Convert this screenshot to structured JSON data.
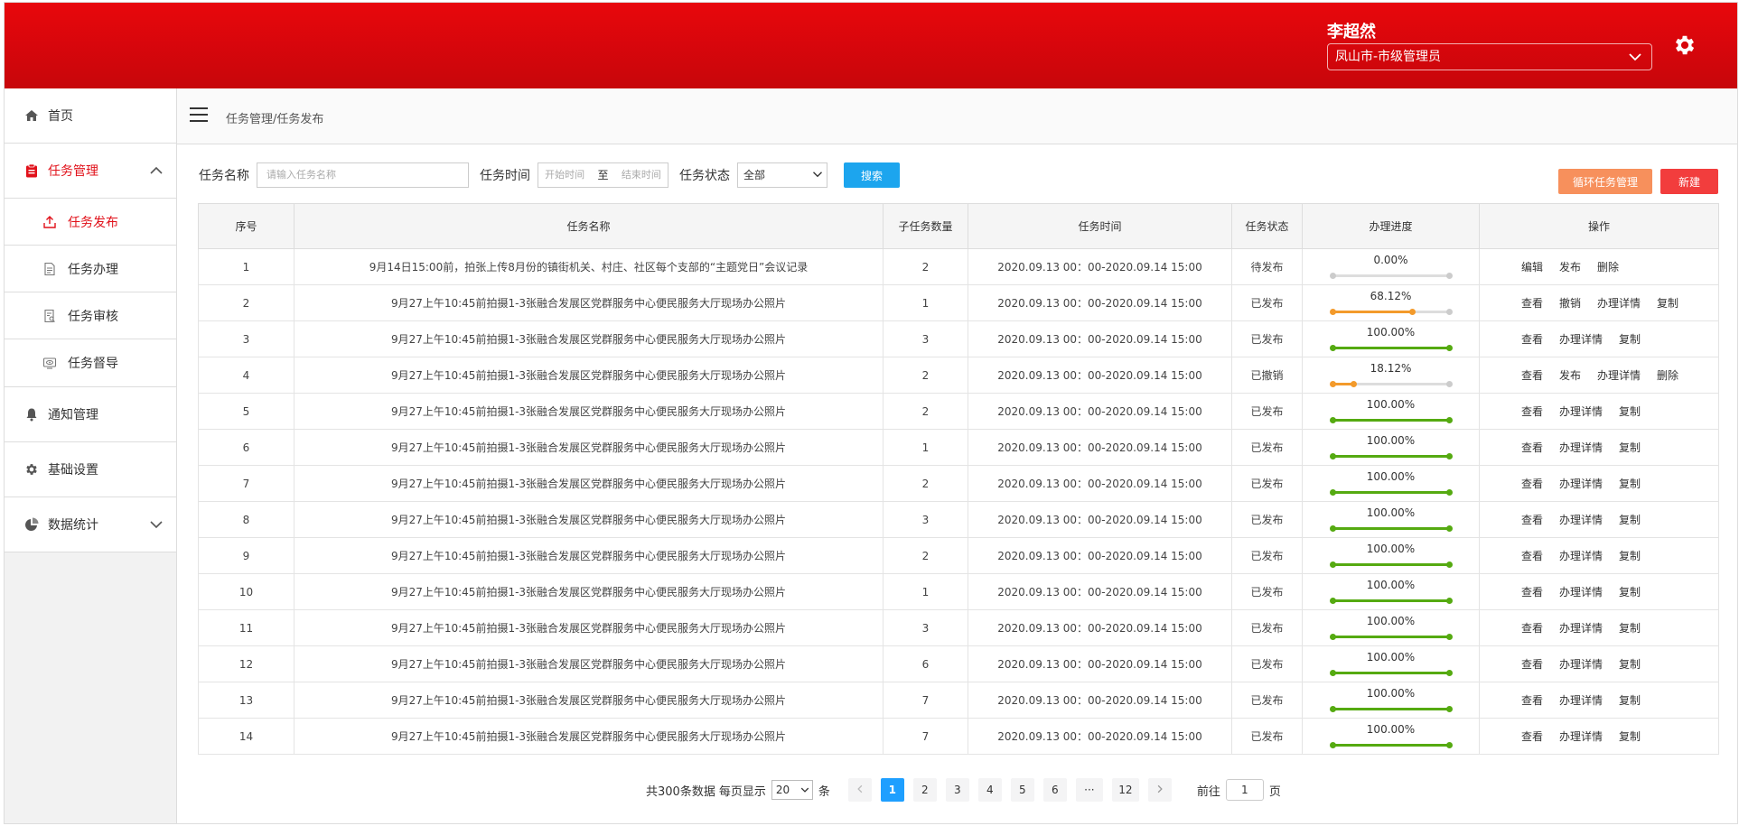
{
  "header": {
    "user_name": "李超然",
    "role": "凤山市-市级管理员"
  },
  "sidebar": {
    "home": "首页",
    "task_mgmt": "任务管理",
    "sub": [
      "任务发布",
      "任务办理",
      "任务审核",
      "任务督导"
    ],
    "notice": "通知管理",
    "settings": "基础设置",
    "stats": "数据统计"
  },
  "breadcrumb": "任务管理/任务发布",
  "filters": {
    "name_label": "任务名称",
    "name_placeholder": "请输入任务名称",
    "time_label": "任务时间",
    "start_placeholder": "开始时间",
    "to": "至",
    "end_placeholder": "结束时间",
    "status_label": "任务状态",
    "status_value": "全部",
    "search": "搜索"
  },
  "actions": {
    "cycle": "循环任务管理",
    "new": "新建"
  },
  "table": {
    "headers": [
      "序号",
      "任务名称",
      "子任务数量",
      "任务时间",
      "任务状态",
      "办理进度",
      "操作"
    ],
    "rows": [
      {
        "no": "1",
        "name": "9月14日15:00前，拍张上传8月份的镇街机关、村庄、社区每个支部的“主题党日”会议记录",
        "count": "2",
        "time": "2020.09.13 00：00-2020.09.14 15:00",
        "status": "待发布",
        "progress": 0,
        "pct": "0.00%",
        "ops": [
          "编辑",
          "发布",
          "删除"
        ]
      },
      {
        "no": "2",
        "name": "9月27上午10:45前拍摄1-3张融合发展区党群服务中心便民服务大厅现场办公照片",
        "count": "1",
        "time": "2020.09.13 00：00-2020.09.14 15:00",
        "status": "已发布",
        "progress": 68.12,
        "pct": "68.12%",
        "ops": [
          "查看",
          "撤销",
          "办理详情",
          "复制"
        ]
      },
      {
        "no": "3",
        "name": "9月27上午10:45前拍摄1-3张融合发展区党群服务中心便民服务大厅现场办公照片",
        "count": "3",
        "time": "2020.09.13 00：00-2020.09.14 15:00",
        "status": "已发布",
        "progress": 100,
        "pct": "100.00%",
        "ops": [
          "查看",
          "办理详情",
          "复制"
        ]
      },
      {
        "no": "4",
        "name": "9月27上午10:45前拍摄1-3张融合发展区党群服务中心便民服务大厅现场办公照片",
        "count": "2",
        "time": "2020.09.13 00：00-2020.09.14 15:00",
        "status": "已撤销",
        "progress": 18.12,
        "pct": "18.12%",
        "ops": [
          "查看",
          "发布",
          "办理详情",
          "删除"
        ]
      },
      {
        "no": "5",
        "name": "9月27上午10:45前拍摄1-3张融合发展区党群服务中心便民服务大厅现场办公照片",
        "count": "2",
        "time": "2020.09.13 00：00-2020.09.14 15:00",
        "status": "已发布",
        "progress": 100,
        "pct": "100.00%",
        "ops": [
          "查看",
          "办理详情",
          "复制"
        ]
      },
      {
        "no": "6",
        "name": "9月27上午10:45前拍摄1-3张融合发展区党群服务中心便民服务大厅现场办公照片",
        "count": "1",
        "time": "2020.09.13 00：00-2020.09.14 15:00",
        "status": "已发布",
        "progress": 100,
        "pct": "100.00%",
        "ops": [
          "查看",
          "办理详情",
          "复制"
        ]
      },
      {
        "no": "7",
        "name": "9月27上午10:45前拍摄1-3张融合发展区党群服务中心便民服务大厅现场办公照片",
        "count": "2",
        "time": "2020.09.13 00：00-2020.09.14 15:00",
        "status": "已发布",
        "progress": 100,
        "pct": "100.00%",
        "ops": [
          "查看",
          "办理详情",
          "复制"
        ]
      },
      {
        "no": "8",
        "name": "9月27上午10:45前拍摄1-3张融合发展区党群服务中心便民服务大厅现场办公照片",
        "count": "3",
        "time": "2020.09.13 00：00-2020.09.14 15:00",
        "status": "已发布",
        "progress": 100,
        "pct": "100.00%",
        "ops": [
          "查看",
          "办理详情",
          "复制"
        ]
      },
      {
        "no": "9",
        "name": "9月27上午10:45前拍摄1-3张融合发展区党群服务中心便民服务大厅现场办公照片",
        "count": "2",
        "time": "2020.09.13 00：00-2020.09.14 15:00",
        "status": "已发布",
        "progress": 100,
        "pct": "100.00%",
        "ops": [
          "查看",
          "办理详情",
          "复制"
        ]
      },
      {
        "no": "10",
        "name": "9月27上午10:45前拍摄1-3张融合发展区党群服务中心便民服务大厅现场办公照片",
        "count": "1",
        "time": "2020.09.13 00：00-2020.09.14 15:00",
        "status": "已发布",
        "progress": 100,
        "pct": "100.00%",
        "ops": [
          "查看",
          "办理详情",
          "复制"
        ]
      },
      {
        "no": "11",
        "name": "9月27上午10:45前拍摄1-3张融合发展区党群服务中心便民服务大厅现场办公照片",
        "count": "3",
        "time": "2020.09.13 00：00-2020.09.14 15:00",
        "status": "已发布",
        "progress": 100,
        "pct": "100.00%",
        "ops": [
          "查看",
          "办理详情",
          "复制"
        ]
      },
      {
        "no": "12",
        "name": "9月27上午10:45前拍摄1-3张融合发展区党群服务中心便民服务大厅现场办公照片",
        "count": "6",
        "time": "2020.09.13 00：00-2020.09.14 15:00",
        "status": "已发布",
        "progress": 100,
        "pct": "100.00%",
        "ops": [
          "查看",
          "办理详情",
          "复制"
        ]
      },
      {
        "no": "13",
        "name": "9月27上午10:45前拍摄1-3张融合发展区党群服务中心便民服务大厅现场办公照片",
        "count": "7",
        "time": "2020.09.13 00：00-2020.09.14 15:00",
        "status": "已发布",
        "progress": 100,
        "pct": "100.00%",
        "ops": [
          "查看",
          "办理详情",
          "复制"
        ]
      },
      {
        "no": "14",
        "name": "9月27上午10:45前拍摄1-3张融合发展区党群服务中心便民服务大厅现场办公照片",
        "count": "7",
        "time": "2020.09.13 00：00-2020.09.14 15:00",
        "status": "已发布",
        "progress": 100,
        "pct": "100.00%",
        "ops": [
          "查看",
          "办理详情",
          "复制"
        ]
      }
    ]
  },
  "pagination": {
    "total": "共300条数据",
    "per_page_label": "每页显示",
    "per_page": "20",
    "unit": "条",
    "pages": [
      "1",
      "2",
      "3",
      "4",
      "5",
      "6",
      "···",
      "12"
    ],
    "current": "1",
    "goto_label": "前往",
    "goto_value": "1",
    "page_suffix": "页"
  },
  "colors": {
    "brand_red": "#e1111a",
    "progress_done": "#55aa11",
    "progress_partial": "#f39a2b",
    "accent_blue": "#1e9fff"
  }
}
